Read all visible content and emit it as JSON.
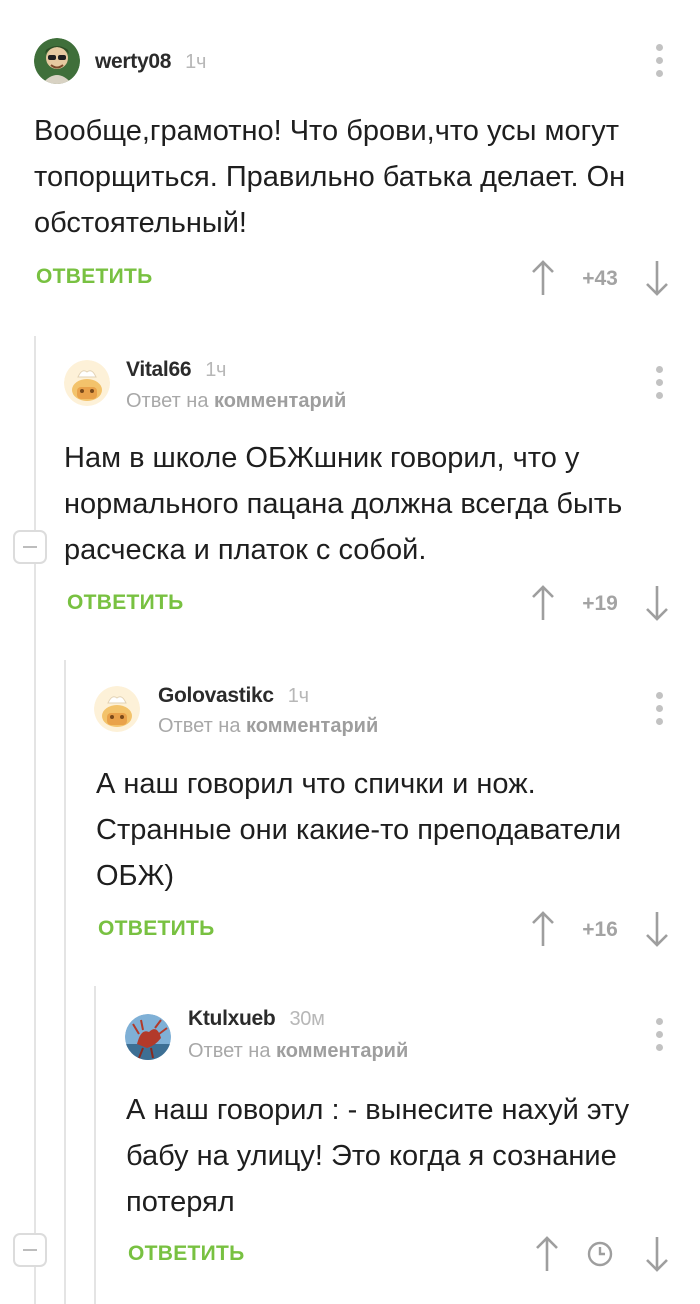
{
  "comments": [
    {
      "author": "werty08",
      "time": "1ч",
      "reply_prefix": "",
      "reply_target": "",
      "text": "Вообще,грамотно! Что брови,что усы могут топорщиться. Правильно батька делает. Он обстоятельный!",
      "reply_label": "ОТВЕТИТЬ",
      "rating": "+43"
    },
    {
      "author": "Vital66",
      "time": "1ч",
      "reply_prefix": "Ответ на",
      "reply_target": "комментарий",
      "text": "Нам в школе ОБЖшник говорил, что у нормального пацана должна всегда быть расческа и платок с собой.",
      "reply_label": "ОТВЕТИТЬ",
      "rating": "+19"
    },
    {
      "author": "Golovastikc",
      "time": "1ч",
      "reply_prefix": "Ответ на",
      "reply_target": "комментарий",
      "text": "А наш говорил что спички и нож. Странные они какие-то преподаватели ОБЖ)",
      "reply_label": "ОТВЕТИТЬ",
      "rating": "+16"
    },
    {
      "author": "Ktulxueb",
      "time": "30м",
      "reply_prefix": "Ответ на",
      "reply_target": "комментарий",
      "text": "А наш говорил : - вынесите нахуй эту бабу на улицу! Это когда я сознание потерял",
      "reply_label": "ОТВЕТИТЬ",
      "rating": ""
    }
  ],
  "colors": {
    "accent_green": "#78c141",
    "muted_gray": "#a3a3a3",
    "thread_line": "#e4e4e4"
  },
  "icons": {
    "menu": "vertical-dots-icon",
    "upvote": "arrow-up-icon",
    "downvote": "arrow-down-icon",
    "pending_rating": "clock-icon",
    "collapse": "collapse-minus-icon"
  }
}
